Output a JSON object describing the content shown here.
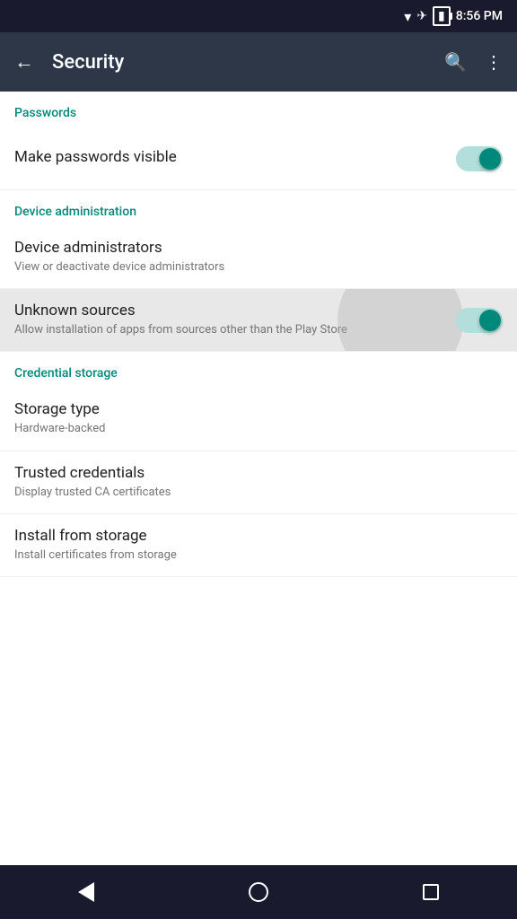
{
  "statusBar": {
    "time": "8:56 PM",
    "icons": [
      "wifi",
      "airplane",
      "battery"
    ]
  },
  "toolbar": {
    "backLabel": "←",
    "title": "Security",
    "searchIcon": "search",
    "moreIcon": "more_vert"
  },
  "sections": [
    {
      "id": "passwords",
      "header": "Passwords",
      "items": [
        {
          "id": "make-passwords-visible",
          "title": "Make passwords visible",
          "subtitle": "",
          "type": "toggle",
          "toggleOn": true,
          "highlighted": false
        }
      ]
    },
    {
      "id": "device-administration",
      "header": "Device administration",
      "items": [
        {
          "id": "device-administrators",
          "title": "Device administrators",
          "subtitle": "View or deactivate device administrators",
          "type": "nav",
          "toggleOn": false,
          "highlighted": false
        },
        {
          "id": "unknown-sources",
          "title": "Unknown sources",
          "subtitle": "Allow installation of apps from sources other than the Play Store",
          "type": "toggle",
          "toggleOn": true,
          "highlighted": true
        }
      ]
    },
    {
      "id": "credential-storage",
      "header": "Credential storage",
      "items": [
        {
          "id": "storage-type",
          "title": "Storage type",
          "subtitle": "Hardware-backed",
          "type": "nav",
          "toggleOn": false,
          "highlighted": false
        },
        {
          "id": "trusted-credentials",
          "title": "Trusted credentials",
          "subtitle": "Display trusted CA certificates",
          "type": "nav",
          "toggleOn": false,
          "highlighted": false
        },
        {
          "id": "install-from-storage",
          "title": "Install from storage",
          "subtitle": "Install certificates from storage",
          "type": "nav",
          "toggleOn": false,
          "highlighted": false
        }
      ]
    }
  ],
  "navBar": {
    "back": "back",
    "home": "home",
    "recent": "recent"
  }
}
